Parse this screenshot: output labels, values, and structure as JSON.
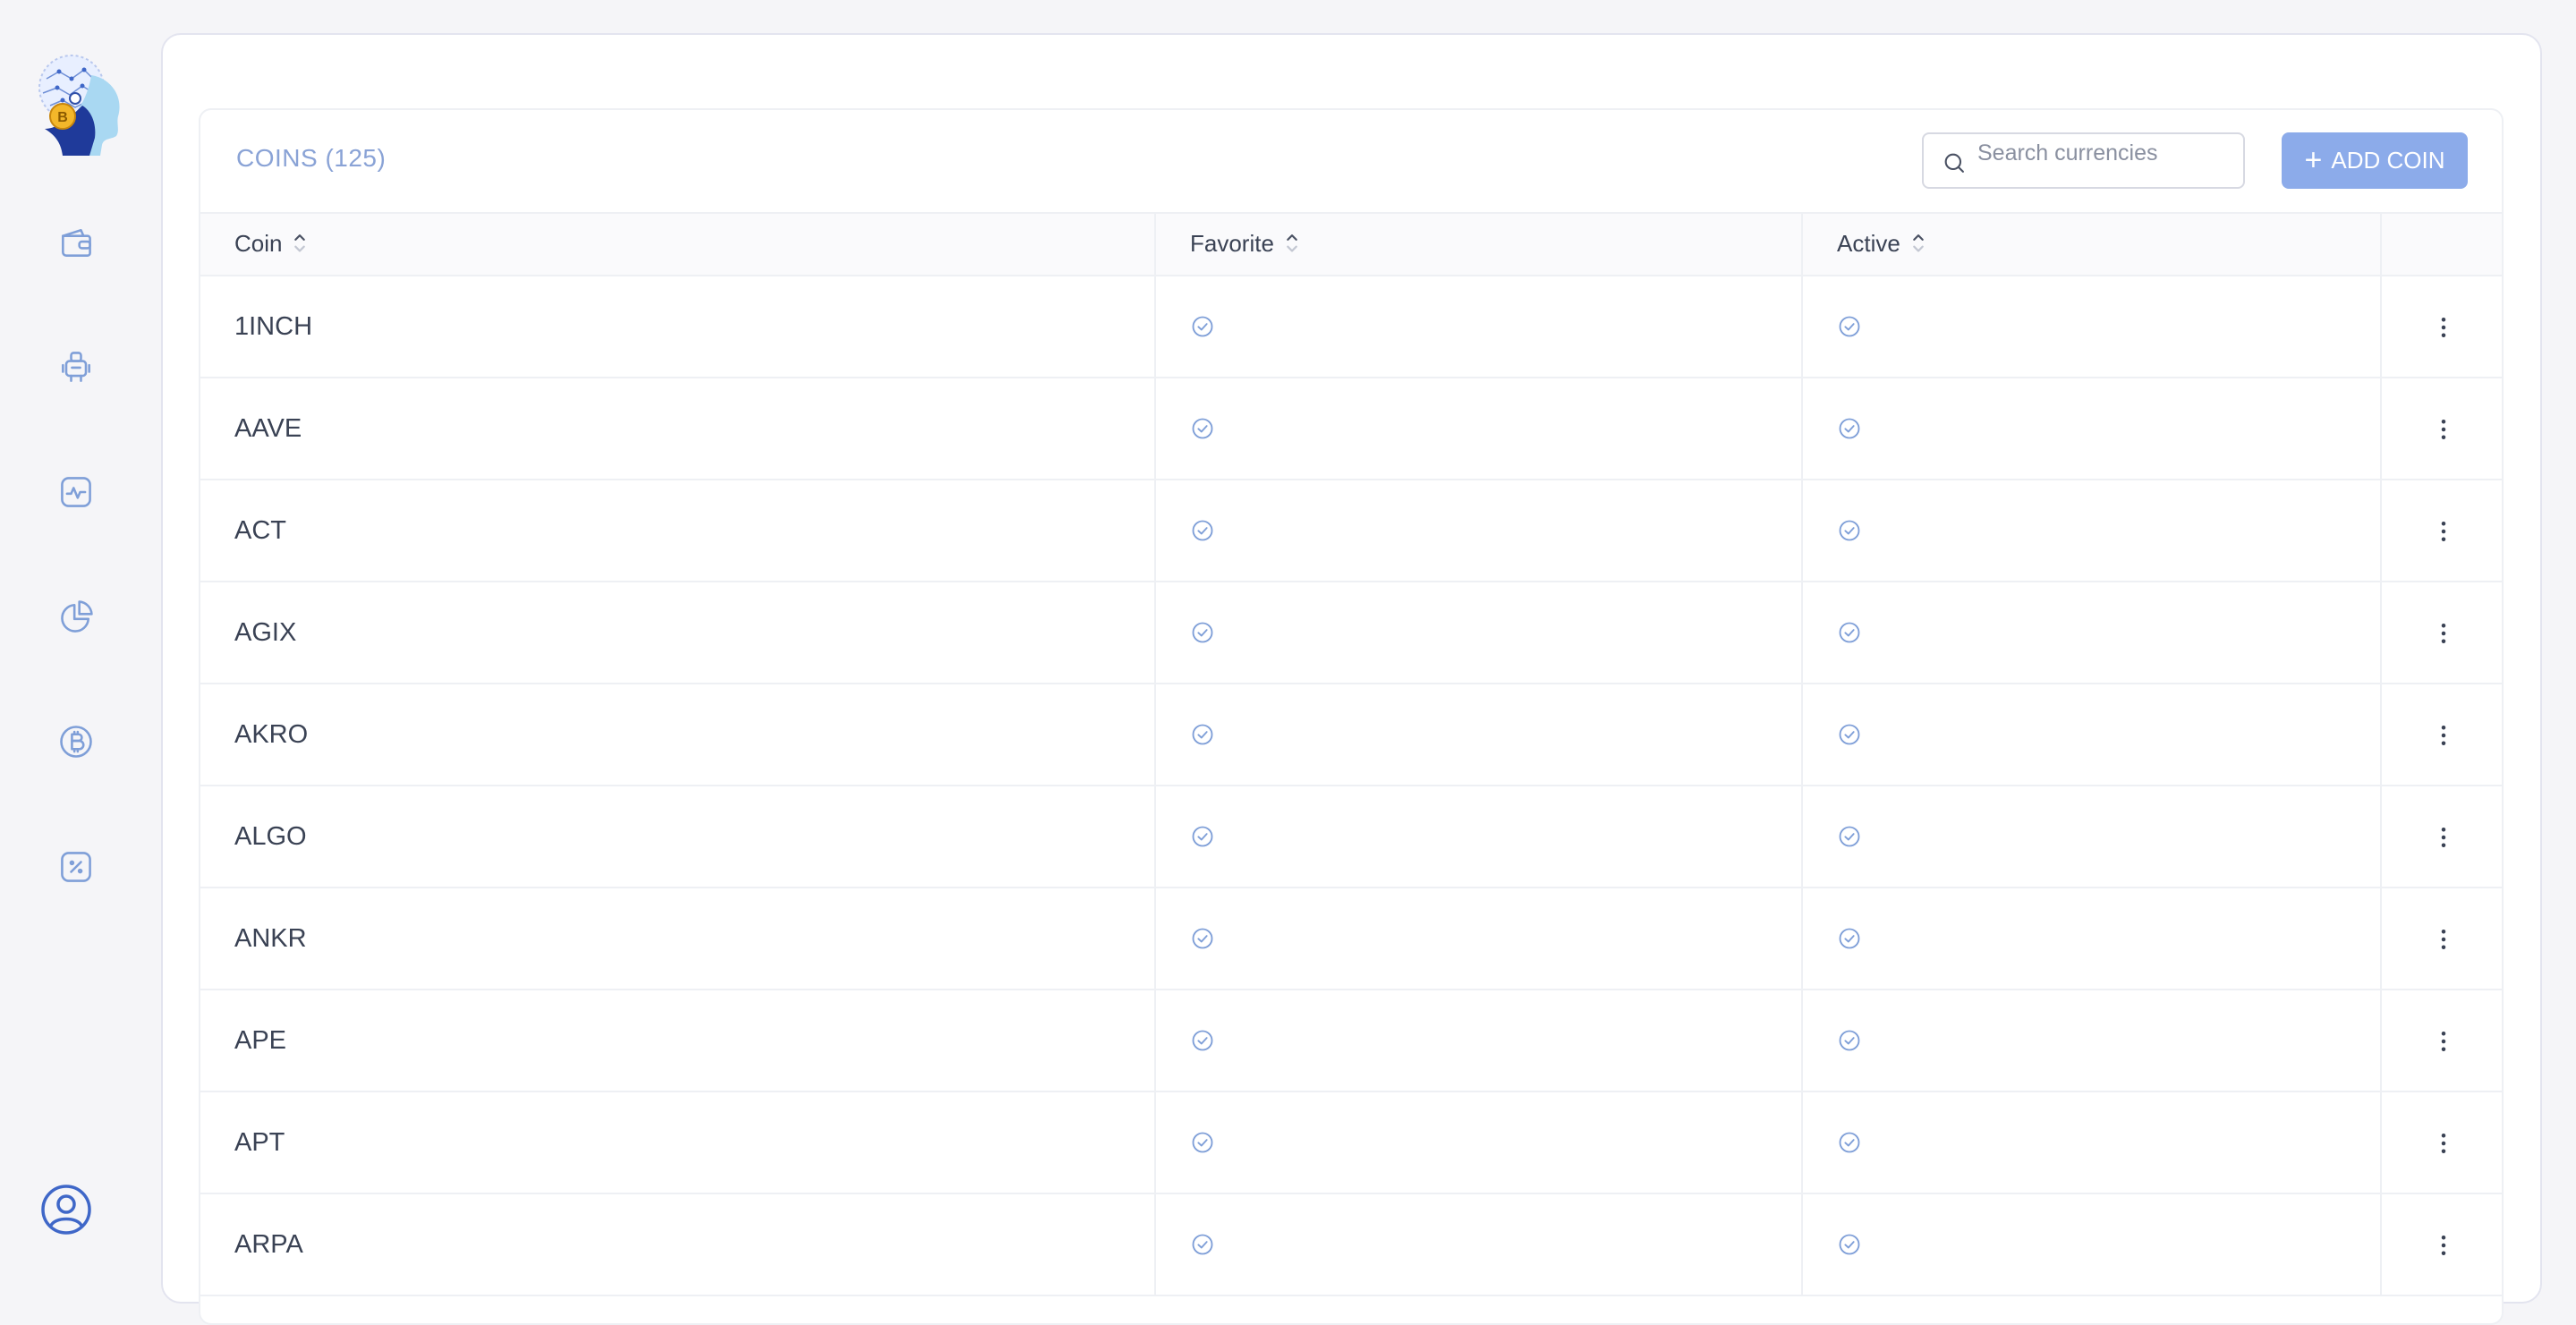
{
  "colors": {
    "accent": "#8cabea",
    "title": "#8aa3d6",
    "icon": "#7f9fd8",
    "text": "#3a4254",
    "background": "#f5f5f8"
  },
  "sidebar": {
    "logo": "ai-robot-bitcoin-logo",
    "items": [
      {
        "name": "wallet",
        "icon": "wallet-icon"
      },
      {
        "name": "bots",
        "icon": "robot-icon"
      },
      {
        "name": "activity",
        "icon": "activity-icon"
      },
      {
        "name": "portfolio",
        "icon": "pie-chart-icon"
      },
      {
        "name": "coins",
        "icon": "bitcoin-icon"
      },
      {
        "name": "discounts",
        "icon": "percent-icon"
      }
    ],
    "user_icon": "user-circle-icon"
  },
  "card": {
    "title": "COINS (125)",
    "search_placeholder": "Search currencies",
    "add_button": "ADD COIN"
  },
  "table": {
    "columns": [
      "Coin",
      "Favorite",
      "Active"
    ],
    "rows": [
      {
        "coin": "1INCH",
        "favorite": true,
        "active": true
      },
      {
        "coin": "AAVE",
        "favorite": true,
        "active": true
      },
      {
        "coin": "ACT",
        "favorite": true,
        "active": true
      },
      {
        "coin": "AGIX",
        "favorite": true,
        "active": true
      },
      {
        "coin": "AKRO",
        "favorite": true,
        "active": true
      },
      {
        "coin": "ALGO",
        "favorite": true,
        "active": true
      },
      {
        "coin": "ANKR",
        "favorite": true,
        "active": true
      },
      {
        "coin": "APE",
        "favorite": true,
        "active": true
      },
      {
        "coin": "APT",
        "favorite": true,
        "active": true
      },
      {
        "coin": "ARPA",
        "favorite": true,
        "active": true
      }
    ]
  }
}
